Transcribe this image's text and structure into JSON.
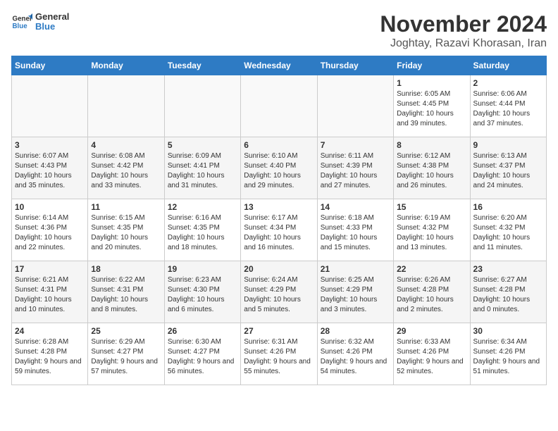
{
  "logo": {
    "line1": "General",
    "line2": "Blue"
  },
  "title": "November 2024",
  "location": "Joghtay, Razavi Khorasan, Iran",
  "weekdays": [
    "Sunday",
    "Monday",
    "Tuesday",
    "Wednesday",
    "Thursday",
    "Friday",
    "Saturday"
  ],
  "weeks": [
    [
      {
        "day": "",
        "info": ""
      },
      {
        "day": "",
        "info": ""
      },
      {
        "day": "",
        "info": ""
      },
      {
        "day": "",
        "info": ""
      },
      {
        "day": "",
        "info": ""
      },
      {
        "day": "1",
        "info": "Sunrise: 6:05 AM\nSunset: 4:45 PM\nDaylight: 10 hours and 39 minutes."
      },
      {
        "day": "2",
        "info": "Sunrise: 6:06 AM\nSunset: 4:44 PM\nDaylight: 10 hours and 37 minutes."
      }
    ],
    [
      {
        "day": "3",
        "info": "Sunrise: 6:07 AM\nSunset: 4:43 PM\nDaylight: 10 hours and 35 minutes."
      },
      {
        "day": "4",
        "info": "Sunrise: 6:08 AM\nSunset: 4:42 PM\nDaylight: 10 hours and 33 minutes."
      },
      {
        "day": "5",
        "info": "Sunrise: 6:09 AM\nSunset: 4:41 PM\nDaylight: 10 hours and 31 minutes."
      },
      {
        "day": "6",
        "info": "Sunrise: 6:10 AM\nSunset: 4:40 PM\nDaylight: 10 hours and 29 minutes."
      },
      {
        "day": "7",
        "info": "Sunrise: 6:11 AM\nSunset: 4:39 PM\nDaylight: 10 hours and 27 minutes."
      },
      {
        "day": "8",
        "info": "Sunrise: 6:12 AM\nSunset: 4:38 PM\nDaylight: 10 hours and 26 minutes."
      },
      {
        "day": "9",
        "info": "Sunrise: 6:13 AM\nSunset: 4:37 PM\nDaylight: 10 hours and 24 minutes."
      }
    ],
    [
      {
        "day": "10",
        "info": "Sunrise: 6:14 AM\nSunset: 4:36 PM\nDaylight: 10 hours and 22 minutes."
      },
      {
        "day": "11",
        "info": "Sunrise: 6:15 AM\nSunset: 4:35 PM\nDaylight: 10 hours and 20 minutes."
      },
      {
        "day": "12",
        "info": "Sunrise: 6:16 AM\nSunset: 4:35 PM\nDaylight: 10 hours and 18 minutes."
      },
      {
        "day": "13",
        "info": "Sunrise: 6:17 AM\nSunset: 4:34 PM\nDaylight: 10 hours and 16 minutes."
      },
      {
        "day": "14",
        "info": "Sunrise: 6:18 AM\nSunset: 4:33 PM\nDaylight: 10 hours and 15 minutes."
      },
      {
        "day": "15",
        "info": "Sunrise: 6:19 AM\nSunset: 4:32 PM\nDaylight: 10 hours and 13 minutes."
      },
      {
        "day": "16",
        "info": "Sunrise: 6:20 AM\nSunset: 4:32 PM\nDaylight: 10 hours and 11 minutes."
      }
    ],
    [
      {
        "day": "17",
        "info": "Sunrise: 6:21 AM\nSunset: 4:31 PM\nDaylight: 10 hours and 10 minutes."
      },
      {
        "day": "18",
        "info": "Sunrise: 6:22 AM\nSunset: 4:31 PM\nDaylight: 10 hours and 8 minutes."
      },
      {
        "day": "19",
        "info": "Sunrise: 6:23 AM\nSunset: 4:30 PM\nDaylight: 10 hours and 6 minutes."
      },
      {
        "day": "20",
        "info": "Sunrise: 6:24 AM\nSunset: 4:29 PM\nDaylight: 10 hours and 5 minutes."
      },
      {
        "day": "21",
        "info": "Sunrise: 6:25 AM\nSunset: 4:29 PM\nDaylight: 10 hours and 3 minutes."
      },
      {
        "day": "22",
        "info": "Sunrise: 6:26 AM\nSunset: 4:28 PM\nDaylight: 10 hours and 2 minutes."
      },
      {
        "day": "23",
        "info": "Sunrise: 6:27 AM\nSunset: 4:28 PM\nDaylight: 10 hours and 0 minutes."
      }
    ],
    [
      {
        "day": "24",
        "info": "Sunrise: 6:28 AM\nSunset: 4:28 PM\nDaylight: 9 hours and 59 minutes."
      },
      {
        "day": "25",
        "info": "Sunrise: 6:29 AM\nSunset: 4:27 PM\nDaylight: 9 hours and 57 minutes."
      },
      {
        "day": "26",
        "info": "Sunrise: 6:30 AM\nSunset: 4:27 PM\nDaylight: 9 hours and 56 minutes."
      },
      {
        "day": "27",
        "info": "Sunrise: 6:31 AM\nSunset: 4:26 PM\nDaylight: 9 hours and 55 minutes."
      },
      {
        "day": "28",
        "info": "Sunrise: 6:32 AM\nSunset: 4:26 PM\nDaylight: 9 hours and 54 minutes."
      },
      {
        "day": "29",
        "info": "Sunrise: 6:33 AM\nSunset: 4:26 PM\nDaylight: 9 hours and 52 minutes."
      },
      {
        "day": "30",
        "info": "Sunrise: 6:34 AM\nSunset: 4:26 PM\nDaylight: 9 hours and 51 minutes."
      }
    ]
  ]
}
